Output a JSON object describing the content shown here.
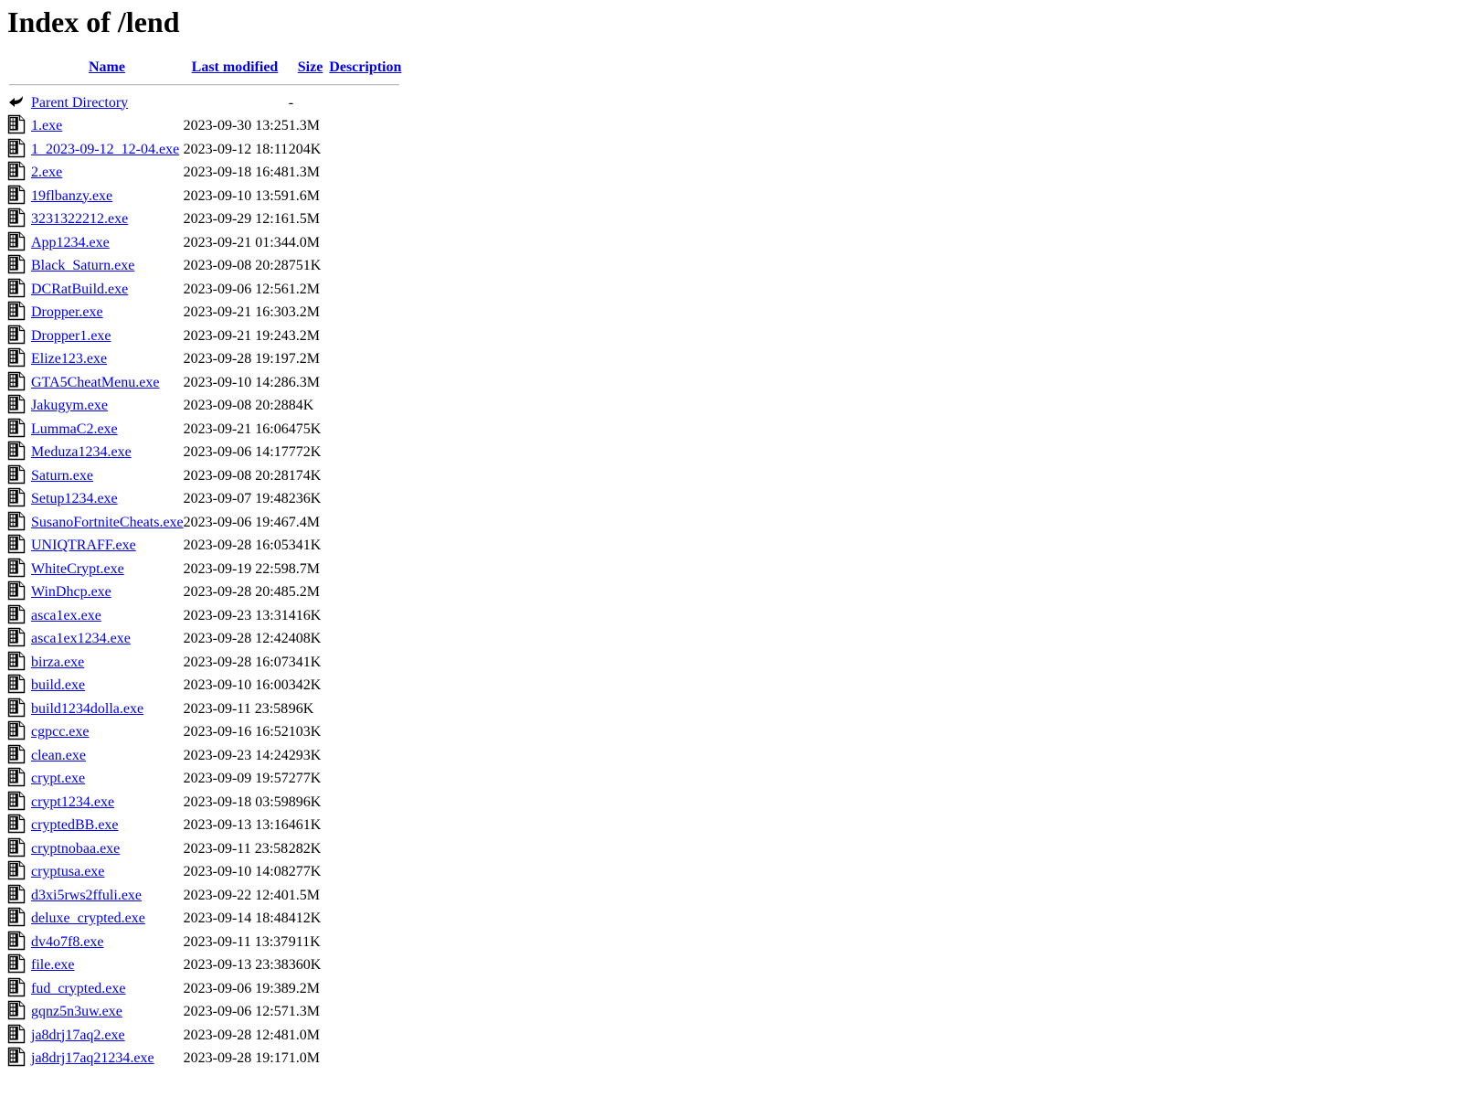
{
  "page": {
    "title": "Index of /lend"
  },
  "table": {
    "headers": {
      "name": "Name",
      "last_modified": "Last modified",
      "size": "Size",
      "description": "Description"
    },
    "parent": {
      "icon": "back-arrow-icon",
      "label": "Parent Directory",
      "last_modified": "",
      "size": "-",
      "description": ""
    },
    "rows": [
      {
        "icon": "binary-file-icon",
        "name": "1.exe",
        "last_modified": "2023-09-30 13:25",
        "size": "1.3M",
        "description": ""
      },
      {
        "icon": "binary-file-icon",
        "name": "1_2023-09-12_12-04.exe",
        "last_modified": "2023-09-12 18:11",
        "size": "204K",
        "description": ""
      },
      {
        "icon": "binary-file-icon",
        "name": "2.exe",
        "last_modified": "2023-09-18 16:48",
        "size": "1.3M",
        "description": ""
      },
      {
        "icon": "binary-file-icon",
        "name": "19flbanzy.exe",
        "last_modified": "2023-09-10 13:59",
        "size": "1.6M",
        "description": ""
      },
      {
        "icon": "binary-file-icon",
        "name": "3231322212.exe",
        "last_modified": "2023-09-29 12:16",
        "size": "1.5M",
        "description": ""
      },
      {
        "icon": "binary-file-icon",
        "name": "App1234.exe",
        "last_modified": "2023-09-21 01:34",
        "size": "4.0M",
        "description": ""
      },
      {
        "icon": "binary-file-icon",
        "name": "Black_Saturn.exe",
        "last_modified": "2023-09-08 20:28",
        "size": "751K",
        "description": ""
      },
      {
        "icon": "binary-file-icon",
        "name": "DCRatBuild.exe",
        "last_modified": "2023-09-06 12:56",
        "size": "1.2M",
        "description": ""
      },
      {
        "icon": "binary-file-icon",
        "name": "Dropper.exe",
        "last_modified": "2023-09-21 16:30",
        "size": "3.2M",
        "description": ""
      },
      {
        "icon": "binary-file-icon",
        "name": "Dropper1.exe",
        "last_modified": "2023-09-21 19:24",
        "size": "3.2M",
        "description": ""
      },
      {
        "icon": "binary-file-icon",
        "name": "Elize123.exe",
        "last_modified": "2023-09-28 19:19",
        "size": "7.2M",
        "description": ""
      },
      {
        "icon": "binary-file-icon",
        "name": "GTA5CheatMenu.exe",
        "last_modified": "2023-09-10 14:28",
        "size": "6.3M",
        "description": ""
      },
      {
        "icon": "binary-file-icon",
        "name": "Jakugym.exe",
        "last_modified": "2023-09-08 20:28",
        "size": "84K",
        "description": ""
      },
      {
        "icon": "binary-file-icon",
        "name": "LummaC2.exe",
        "last_modified": "2023-09-21 16:06",
        "size": "475K",
        "description": ""
      },
      {
        "icon": "binary-file-icon",
        "name": "Meduza1234.exe",
        "last_modified": "2023-09-06 14:17",
        "size": "772K",
        "description": ""
      },
      {
        "icon": "binary-file-icon",
        "name": "Saturn.exe",
        "last_modified": "2023-09-08 20:28",
        "size": "174K",
        "description": ""
      },
      {
        "icon": "binary-file-icon",
        "name": "Setup1234.exe",
        "last_modified": "2023-09-07 19:48",
        "size": "236K",
        "description": ""
      },
      {
        "icon": "binary-file-icon",
        "name": "SusanoFortniteCheats.exe",
        "last_modified": "2023-09-06 19:46",
        "size": "7.4M",
        "description": ""
      },
      {
        "icon": "binary-file-icon",
        "name": "UNIQTRAFF.exe",
        "last_modified": "2023-09-28 16:05",
        "size": "341K",
        "description": ""
      },
      {
        "icon": "binary-file-icon",
        "name": "WhiteCrypt.exe",
        "last_modified": "2023-09-19 22:59",
        "size": "8.7M",
        "description": ""
      },
      {
        "icon": "binary-file-icon",
        "name": "WinDhcp.exe",
        "last_modified": "2023-09-28 20:48",
        "size": "5.2M",
        "description": ""
      },
      {
        "icon": "binary-file-icon",
        "name": "asca1ex.exe",
        "last_modified": "2023-09-23 13:31",
        "size": "416K",
        "description": ""
      },
      {
        "icon": "binary-file-icon",
        "name": "asca1ex1234.exe",
        "last_modified": "2023-09-28 12:42",
        "size": "408K",
        "description": ""
      },
      {
        "icon": "binary-file-icon",
        "name": "birza.exe",
        "last_modified": "2023-09-28 16:07",
        "size": "341K",
        "description": ""
      },
      {
        "icon": "binary-file-icon",
        "name": "build.exe",
        "last_modified": "2023-09-10 16:00",
        "size": "342K",
        "description": ""
      },
      {
        "icon": "binary-file-icon",
        "name": "build1234dolla.exe",
        "last_modified": "2023-09-11 23:58",
        "size": "96K",
        "description": ""
      },
      {
        "icon": "binary-file-icon",
        "name": "cgpcc.exe",
        "last_modified": "2023-09-16 16:52",
        "size": "103K",
        "description": ""
      },
      {
        "icon": "binary-file-icon",
        "name": "clean.exe",
        "last_modified": "2023-09-23 14:24",
        "size": "293K",
        "description": ""
      },
      {
        "icon": "binary-file-icon",
        "name": "crypt.exe",
        "last_modified": "2023-09-09 19:57",
        "size": "277K",
        "description": ""
      },
      {
        "icon": "binary-file-icon",
        "name": "crypt1234.exe",
        "last_modified": "2023-09-18 03:59",
        "size": "896K",
        "description": ""
      },
      {
        "icon": "binary-file-icon",
        "name": "cryptedBB.exe",
        "last_modified": "2023-09-13 13:16",
        "size": "461K",
        "description": ""
      },
      {
        "icon": "binary-file-icon",
        "name": "cryptnobaa.exe",
        "last_modified": "2023-09-11 23:58",
        "size": "282K",
        "description": ""
      },
      {
        "icon": "binary-file-icon",
        "name": "cryptusa.exe",
        "last_modified": "2023-09-10 14:08",
        "size": "277K",
        "description": ""
      },
      {
        "icon": "binary-file-icon",
        "name": "d3xi5rws2ffuli.exe",
        "last_modified": "2023-09-22 12:40",
        "size": "1.5M",
        "description": ""
      },
      {
        "icon": "binary-file-icon",
        "name": "deluxe_crypted.exe",
        "last_modified": "2023-09-14 18:48",
        "size": "412K",
        "description": ""
      },
      {
        "icon": "binary-file-icon",
        "name": "dv4o7f8.exe",
        "last_modified": "2023-09-11 13:37",
        "size": "911K",
        "description": ""
      },
      {
        "icon": "binary-file-icon",
        "name": "file.exe",
        "last_modified": "2023-09-13 23:38",
        "size": "360K",
        "description": ""
      },
      {
        "icon": "binary-file-icon",
        "name": "fud_crypted.exe",
        "last_modified": "2023-09-06 19:38",
        "size": "9.2M",
        "description": ""
      },
      {
        "icon": "binary-file-icon",
        "name": "gqnz5n3uw.exe",
        "last_modified": "2023-09-06 12:57",
        "size": "1.3M",
        "description": ""
      },
      {
        "icon": "binary-file-icon",
        "name": "ja8drj17aq2.exe",
        "last_modified": "2023-09-28 12:48",
        "size": "1.0M",
        "description": ""
      },
      {
        "icon": "binary-file-icon",
        "name": "ja8drj17aq21234.exe",
        "last_modified": "2023-09-28 19:17",
        "size": "1.0M",
        "description": ""
      }
    ]
  },
  "colors": {
    "link": "#0000EE",
    "text": "#000000",
    "background": "#FFFFFF",
    "rule": "#BBBBBB"
  }
}
